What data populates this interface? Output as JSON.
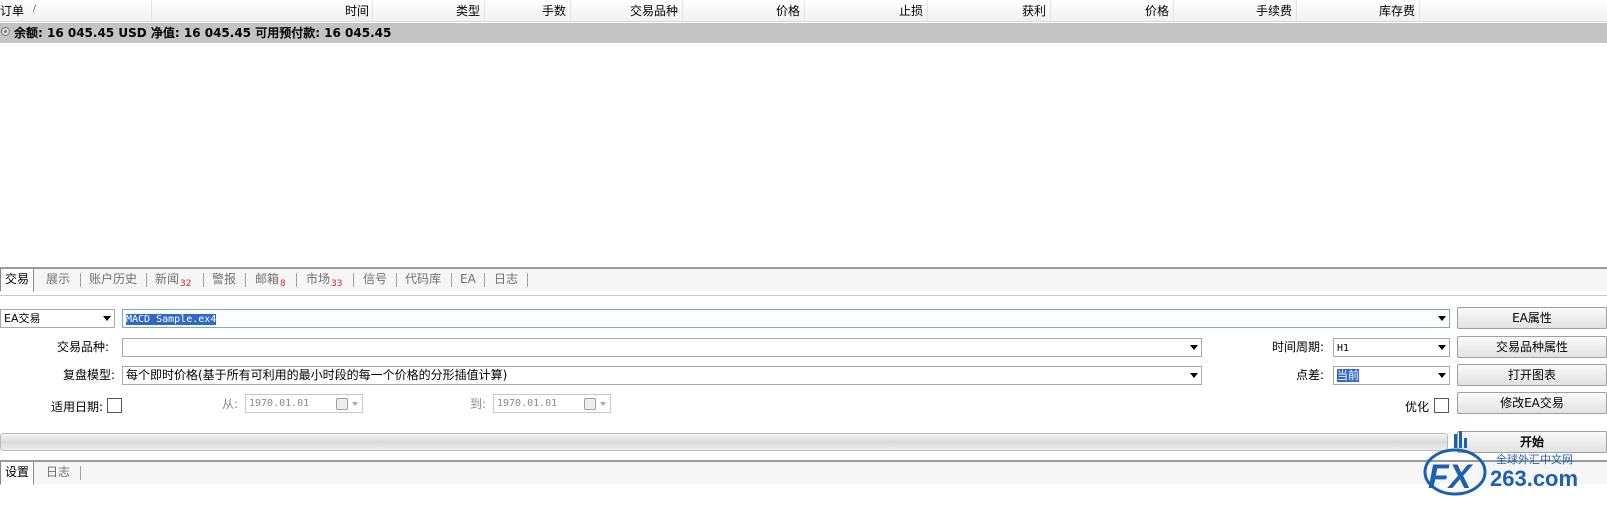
{
  "terminal": {
    "columns": [
      "订单",
      "时间",
      "类型",
      "手数",
      "交易品种",
      "价格",
      "止损",
      "获利",
      "价格",
      "手续费",
      "库存费"
    ],
    "sort_indicator": "/",
    "balance_text": "余额: 16 045.45 USD  净值: 16 045.45  可用预付款: 16 045.45"
  },
  "terminal_tabs": [
    {
      "label": "交易",
      "badge": ""
    },
    {
      "label": "展示",
      "badge": ""
    },
    {
      "label": "账户历史",
      "badge": ""
    },
    {
      "label": "新闻",
      "badge": "32"
    },
    {
      "label": "警报",
      "badge": ""
    },
    {
      "label": "邮箱",
      "badge": "8"
    },
    {
      "label": "市场",
      "badge": "33"
    },
    {
      "label": "信号",
      "badge": ""
    },
    {
      "label": "代码库",
      "badge": ""
    },
    {
      "label": "EA",
      "badge": ""
    },
    {
      "label": "日志",
      "badge": ""
    }
  ],
  "tester": {
    "mode_select": "EA交易",
    "expert_value": "MACD Sample.ex4",
    "symbol_label": "交易品种:",
    "symbol_value": "",
    "model_label": "复盘模型:",
    "model_value": "每个即时价格(基于所有可利用的最小时段的每一个价格的分形插值计算)",
    "use_date_label": "适用日期:",
    "from_label": "从:",
    "from_value": "1970.01.01",
    "to_label": "到:",
    "to_value": "1970.01.01",
    "period_label": "时间周期:",
    "period_value": "H1",
    "spread_label": "点差:",
    "spread_value": "当前",
    "optimize_label": "优化",
    "buttons": {
      "expert_properties": "EA属性",
      "symbol_properties": "交易品种属性",
      "open_chart": "打开图表",
      "modify_expert": "修改EA交易",
      "start": "开始"
    }
  },
  "bottom_tabs": [
    {
      "label": "设置"
    },
    {
      "label": "日志"
    }
  ],
  "watermark": {
    "text_cn": "全球外汇中文网",
    "text_domain": "263.com",
    "text_fx": "FX"
  }
}
